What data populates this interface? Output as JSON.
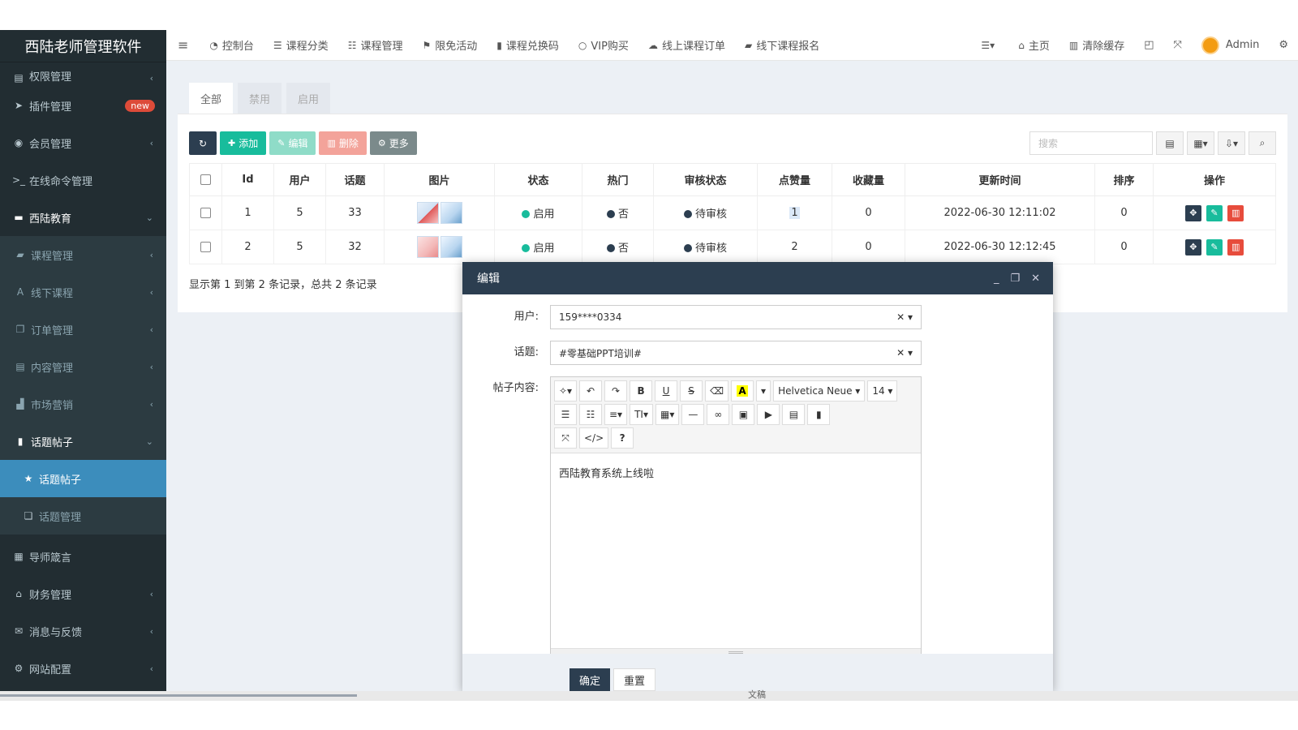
{
  "brand": "西陆老师管理软件",
  "sidebar": {
    "cut_item": "权限管理",
    "items": [
      {
        "label": "插件管理",
        "badge": "new"
      },
      {
        "label": "会员管理"
      },
      {
        "label": "在线命令管理"
      },
      {
        "label": "西陆教育"
      },
      {
        "label": "课程管理"
      },
      {
        "label": "线下课程"
      },
      {
        "label": "订单管理"
      },
      {
        "label": "内容管理"
      },
      {
        "label": "市场营销"
      },
      {
        "label": "话题帖子"
      },
      {
        "label": "话题帖子"
      },
      {
        "label": "话题管理"
      },
      {
        "label": "导师箴言"
      },
      {
        "label": "财务管理"
      },
      {
        "label": "消息与反馈"
      },
      {
        "label": "网站配置"
      }
    ]
  },
  "topnav": {
    "items": [
      "控制台",
      "课程分类",
      "课程管理",
      "限免活动",
      "课程兑换码",
      "VIP购买",
      "线上课程订单",
      "线下课程报名"
    ],
    "home": "主页",
    "clear_cache": "清除缓存",
    "user": "Admin"
  },
  "tabs": [
    "全部",
    "禁用",
    "启用"
  ],
  "toolbar": {
    "add": "添加",
    "edit": "编辑",
    "delete": "删除",
    "more": "更多"
  },
  "search": {
    "placeholder": "搜索"
  },
  "table": {
    "headers": [
      "Id",
      "用户",
      "话题",
      "图片",
      "状态",
      "热门",
      "审核状态",
      "点赞量",
      "收藏量",
      "更新时间",
      "排序",
      "操作"
    ],
    "rows": [
      {
        "id": "1",
        "user": "5",
        "topic": "33",
        "status": "启用",
        "hot": "否",
        "review": "待审核",
        "likes": "1",
        "favs": "0",
        "updated": "2022-06-30 12:11:02",
        "sort": "0"
      },
      {
        "id": "2",
        "user": "5",
        "topic": "32",
        "status": "启用",
        "hot": "否",
        "review": "待审核",
        "likes": "2",
        "favs": "0",
        "updated": "2022-06-30 12:12:45",
        "sort": "0"
      }
    ],
    "summary": "显示第 1 到第 2 条记录，总共 2 条记录"
  },
  "modal": {
    "title": "编辑",
    "user_label": "用户:",
    "user_value": "159****0334",
    "topic_label": "话题:",
    "topic_value": "#零基础PPT培训#",
    "content_label": "帖子内容:",
    "font_name": "Helvetica Neue",
    "font_size": "14",
    "content": "西陆教育系统上线啦",
    "ok": "确定",
    "reset": "重置"
  },
  "bottom_label": "文稿",
  "colors": {
    "sidebar_bg": "#222d32",
    "active": "#3c8dbc",
    "success": "#18bc9c",
    "danger": "#e74c3c",
    "dark": "#2c3e50"
  }
}
